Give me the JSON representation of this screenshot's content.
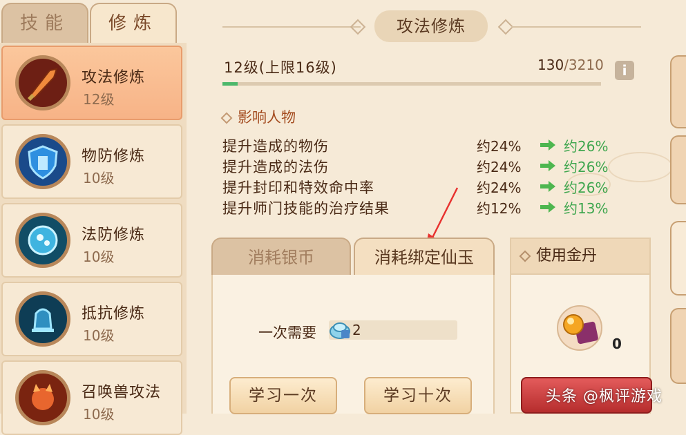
{
  "top_tabs": [
    "技能",
    "修炼"
  ],
  "skills": [
    {
      "name": "攻法修炼",
      "level": "12级",
      "icon": "blade-icon"
    },
    {
      "name": "物防修炼",
      "level": "10级",
      "icon": "shield-icon"
    },
    {
      "name": "法防修炼",
      "level": "10级",
      "icon": "orb-icon"
    },
    {
      "name": "抵抗修炼",
      "level": "10级",
      "icon": "bell-icon"
    },
    {
      "name": "召唤兽攻法",
      "level": "10级",
      "icon": "demon-icon"
    }
  ],
  "header": {
    "title": "攻法修炼"
  },
  "level": {
    "text": "12级(上限16级)",
    "exp_current": "130",
    "exp_max": "/3210",
    "progress": 0.04
  },
  "effects": {
    "label": "影响人物",
    "rows": [
      {
        "name": "提升造成的物伤",
        "current": "约24%",
        "next": "约26%"
      },
      {
        "name": "提升造成的法伤",
        "current": "约24%",
        "next": "约26%"
      },
      {
        "name": "提升封印和特效命中率",
        "current": "约24%",
        "next": "约26%"
      },
      {
        "name": "提升师门技能的治疗结果",
        "current": "约12%",
        "next": "约13%"
      }
    ]
  },
  "cost": {
    "tab_silver": "消耗银币",
    "tab_jade": "消耗绑定仙玉",
    "need_label": "一次需要",
    "need_value": "2",
    "learn_once": "学习一次",
    "learn_ten": "学习十次"
  },
  "gold": {
    "title": "使用金丹",
    "count": "0"
  },
  "watermark": "头条 @枫评游戏",
  "colors": {
    "accent_green": "#3ea64e",
    "selected": "#f7b387",
    "title_red": "#a34a1e"
  }
}
